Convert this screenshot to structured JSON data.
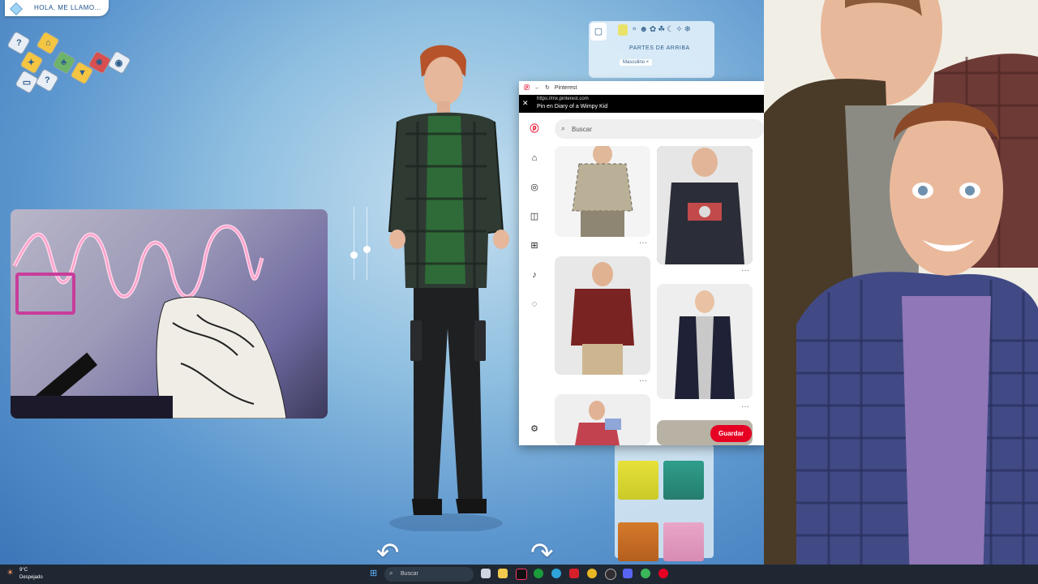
{
  "game": {
    "name_prompt": "HOLA, ME LLAMO...",
    "category": "PARTES DE ARRIBA",
    "gender_tag": "Masculino ×",
    "help_icon": "?"
  },
  "browser": {
    "title": "Pinterest",
    "url": "https://mx.pinterest.com",
    "page_title": "Pin en Diary of a Wimpy Kid",
    "search_placeholder": "Buscar",
    "save_label": "Guardar",
    "more": "···"
  },
  "taskbar": {
    "temperature": "9°C",
    "condition": "Despejado",
    "search_label": "Buscar"
  }
}
